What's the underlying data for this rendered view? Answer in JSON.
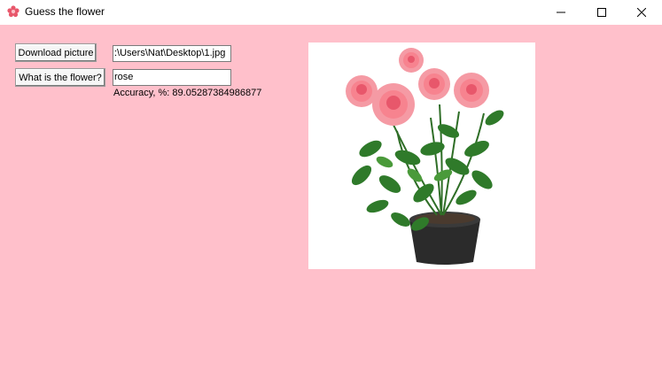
{
  "window": {
    "title": "Guess the flower",
    "controls": {
      "minimize_icon": "minimize-icon",
      "maximize_icon": "maximize-icon",
      "close_icon": "close-icon"
    }
  },
  "toolbar": {
    "download_label": "Download picture",
    "predict_label": "What is the flower?"
  },
  "fields": {
    "path_value": ":\\Users\\Nat\\Desktop\\1.jpg",
    "result_value": "rose"
  },
  "result": {
    "accuracy_text": "Accuracy, %: 89.05287384986877"
  },
  "colors": {
    "background": "#ffc0cb",
    "titlebar": "#ffffff",
    "rose_petal": "#f7838f",
    "leaf": "#2f7a2a",
    "pot": "#2b2b2b"
  }
}
